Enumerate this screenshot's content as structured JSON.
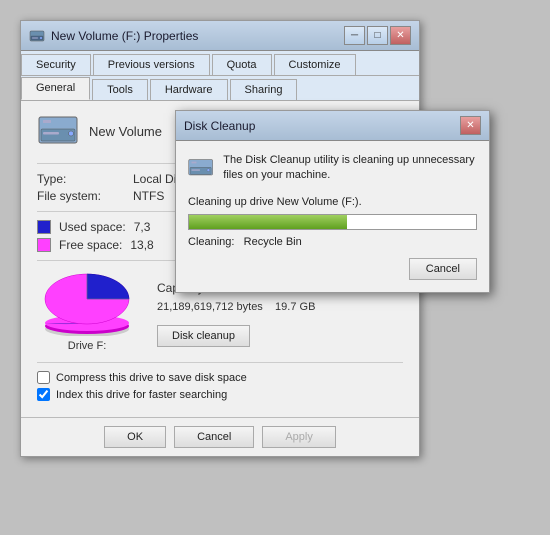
{
  "mainWindow": {
    "title": "New Volume (F:) Properties",
    "tabs_row1": [
      "Security",
      "Previous versions",
      "Quota",
      "Customize"
    ],
    "tabs_row2": [
      "General",
      "Tools",
      "Hardware",
      "Sharing"
    ],
    "active_tab": "General",
    "volume_name": "New Volume",
    "type_label": "Type:",
    "type_value": "Local Disk",
    "filesystem_label": "File system:",
    "filesystem_value": "NTFS",
    "used_label": "Used space:",
    "used_value": "7,3",
    "free_label": "Free space:",
    "free_value": "13,8",
    "capacity_label": "Capacity:",
    "capacity_bytes": "21,189,619,712 bytes",
    "capacity_gb": "19.7 GB",
    "drive_label": "Drive F:",
    "disk_cleanup_btn": "Disk cleanup",
    "compress_label": "Compress this drive to save disk space",
    "index_label": "Index this drive for faster searching",
    "ok_btn": "OK",
    "cancel_btn": "Cancel",
    "apply_btn": "Apply"
  },
  "cleanupDialog": {
    "title": "Disk Cleanup",
    "message": "The Disk Cleanup utility is cleaning up unnecessary files on your machine.",
    "drive_label": "Cleaning up drive New Volume (F:).",
    "status_label": "Cleaning:",
    "status_value": "Recycle Bin",
    "cancel_btn": "Cancel",
    "progress": 55
  },
  "icons": {
    "minimize": "─",
    "maximize": "□",
    "close": "✕"
  }
}
